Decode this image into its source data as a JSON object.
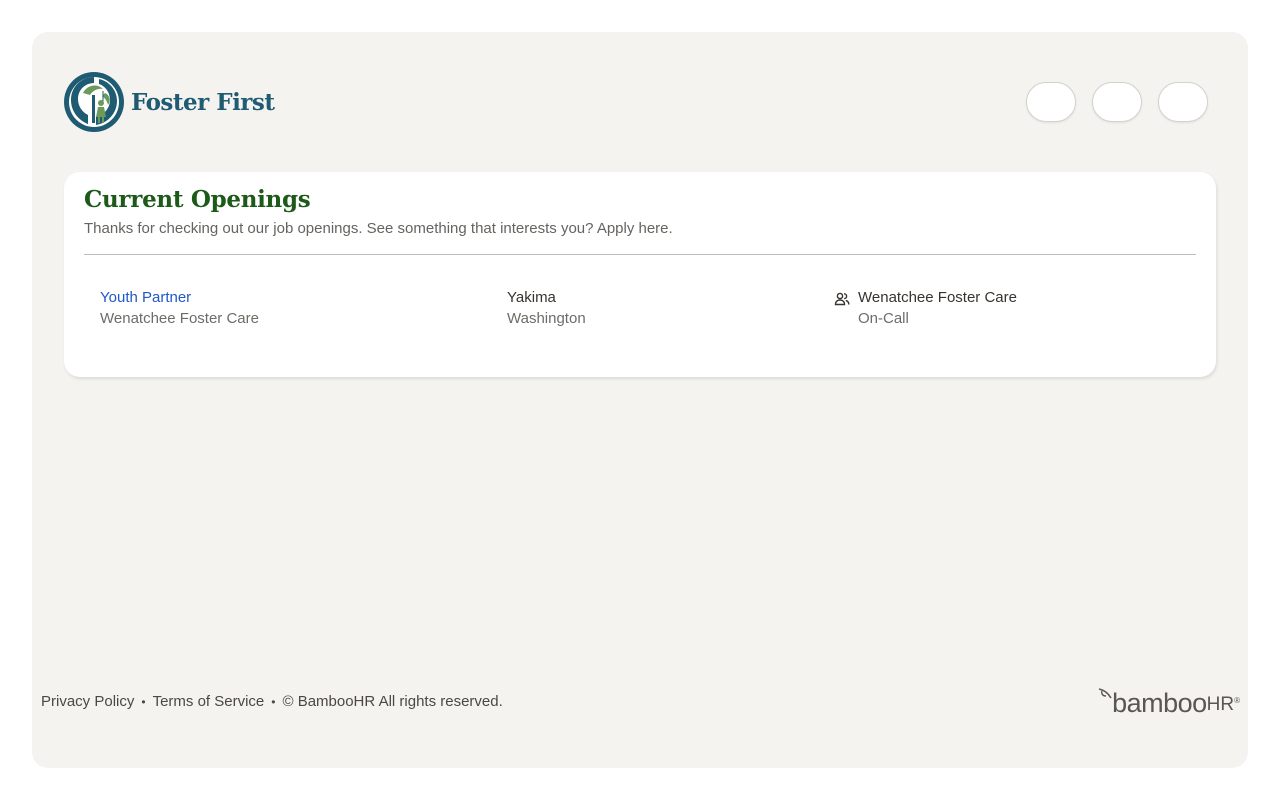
{
  "company": {
    "name": "Foster First",
    "brand_color": "#1f5c73",
    "accent_green": "#6b9a5a"
  },
  "header": {
    "icon_buttons": [
      "",
      "",
      ""
    ]
  },
  "openings": {
    "title": "Current Openings",
    "subtitle": "Thanks for checking out our job openings. See something that interests you? Apply here.",
    "title_color": "#1d5a19",
    "jobs": [
      {
        "title": "Youth Partner",
        "department_sub": "Wenatchee Foster Care",
        "city": "Yakima",
        "state": "Washington",
        "department": "Wenatchee Foster Care",
        "employment_type": "On-Call",
        "icon": "users-icon"
      }
    ]
  },
  "footer": {
    "privacy": "Privacy Policy",
    "terms": "Terms of Service",
    "copyright": "© BambooHR All rights reserved.",
    "separator": "•",
    "powered_by": {
      "word": "bamboo",
      "suffix": "HR",
      "reg": "®"
    }
  }
}
